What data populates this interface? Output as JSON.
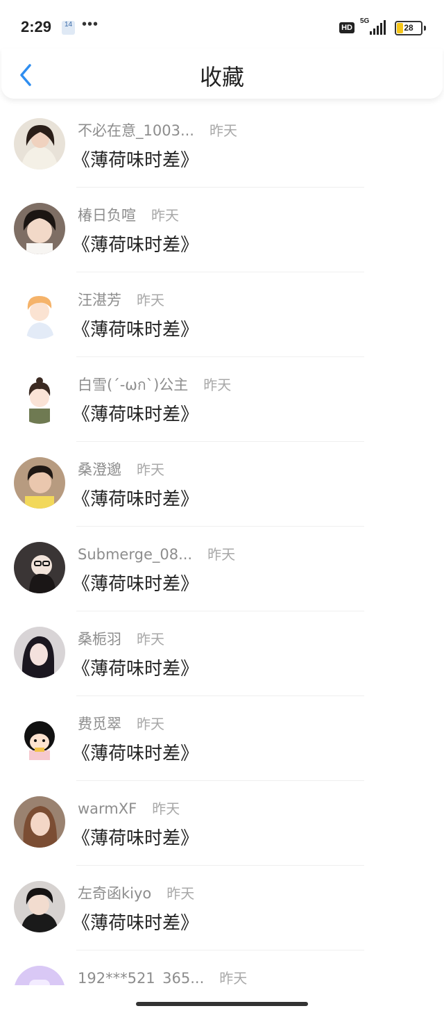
{
  "status_bar": {
    "time": "2:29",
    "notification_badge": "14",
    "more_dots": "•••",
    "hd_label": "HD",
    "network_label": "5G",
    "battery_level": "28"
  },
  "header": {
    "title": "收藏",
    "back_icon": "chevron-left-icon",
    "accent_color": "#2f8ef0"
  },
  "favorites": [
    {
      "username": "不必在意_1003...",
      "time": "昨天",
      "title": "《薄荷味时差》",
      "avatar_bg": "#cfc2b6"
    },
    {
      "username": "椿日负喧",
      "time": "昨天",
      "title": "《薄荷味时差》",
      "avatar_bg": "#8a7a6e"
    },
    {
      "username": "汪湛芳",
      "time": "昨天",
      "title": "《薄荷味时差》",
      "avatar_bg": "#ffffff"
    },
    {
      "username": "白雪(ˊ-ωก`)公主",
      "time": "昨天",
      "title": "《薄荷味时差》",
      "avatar_bg": "#ffffff"
    },
    {
      "username": "桑澄邈",
      "time": "昨天",
      "title": "《薄荷味时差》",
      "avatar_bg": "#b89a7c"
    },
    {
      "username": "Submerge_08...",
      "time": "昨天",
      "title": "《薄荷味时差》",
      "avatar_bg": "#3a3a3a"
    },
    {
      "username": "桑栀羽",
      "time": "昨天",
      "title": "《薄荷味时差》",
      "avatar_bg": "#d8d4d6"
    },
    {
      "username": "费觅翠",
      "time": "昨天",
      "title": "《薄荷味时差》",
      "avatar_bg": "#ffffff"
    },
    {
      "username": "warmXF",
      "time": "昨天",
      "title": "《薄荷味时差》",
      "avatar_bg": "#a88a72"
    },
    {
      "username": "左奇函kiyo",
      "time": "昨天",
      "title": "《薄荷味时差》",
      "avatar_bg": "#d9d6d4"
    },
    {
      "username": "192***521_365...",
      "time": "昨天",
      "title": "",
      "avatar_bg": "#d9c8f5"
    }
  ]
}
